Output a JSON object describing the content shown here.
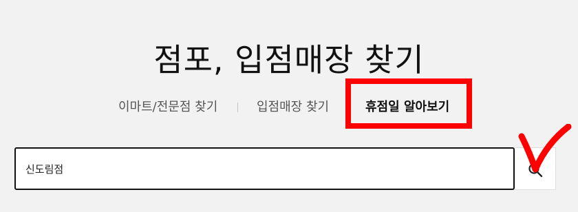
{
  "header": {
    "title": "점포, 입점매장 찾기"
  },
  "tabs": [
    {
      "label": "이마트/전문점 찾기"
    },
    {
      "label": "입점매장 찾기"
    },
    {
      "label": "휴점일 알아보기",
      "active": true
    }
  ],
  "search": {
    "value": "신도림점",
    "button_icon": "search-icon"
  },
  "annotations": {
    "highlight_color": "#ff0000",
    "highlight_icon": "highlight-box",
    "checkmark_icon": "check-mark-icon"
  }
}
